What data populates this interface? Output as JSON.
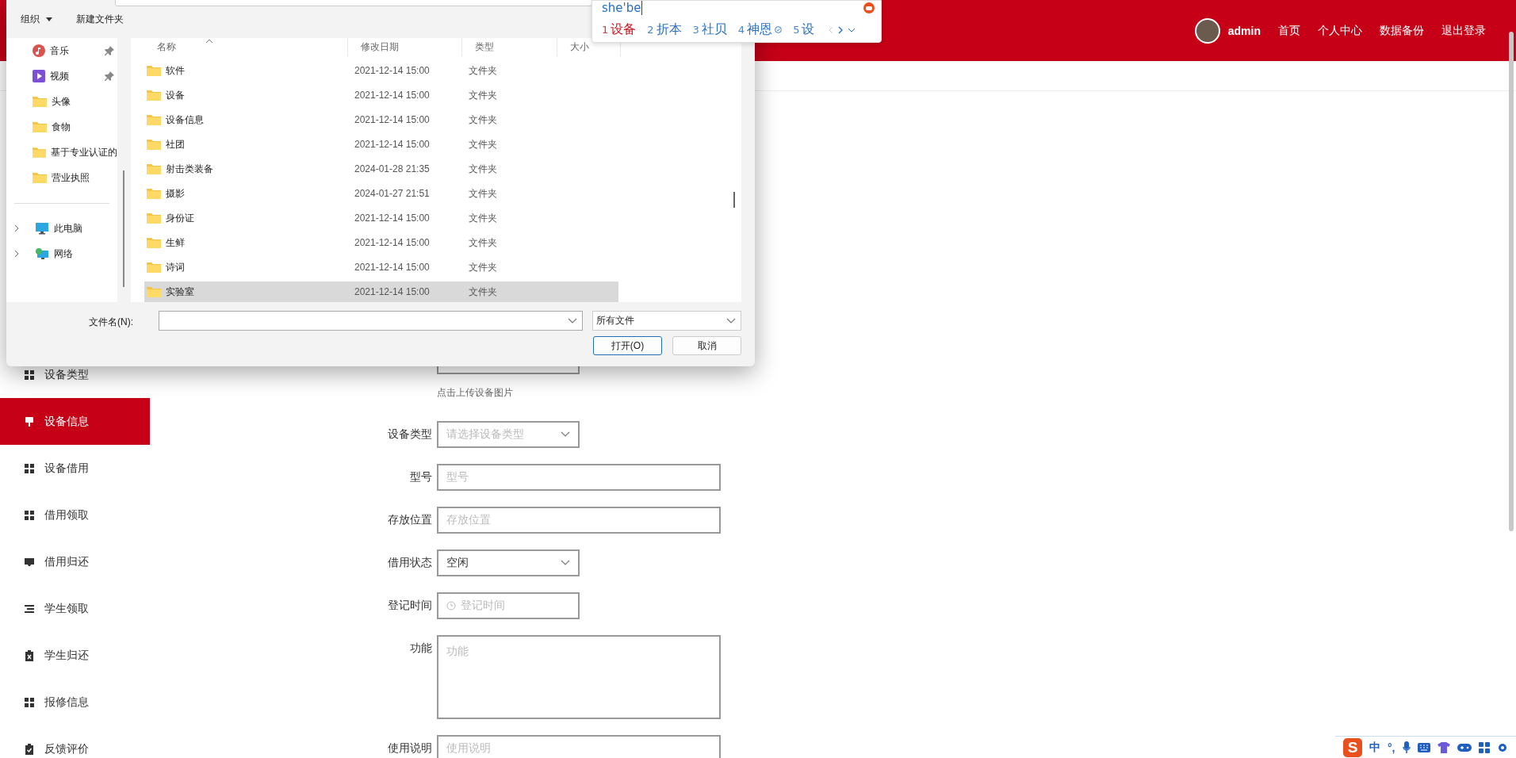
{
  "header": {
    "user": "admin",
    "nav": [
      "首页",
      "个人中心",
      "数据备份",
      "退出登录"
    ]
  },
  "sidebar": {
    "items": [
      {
        "label": "设备类型",
        "kind": "grid",
        "selected": false
      },
      {
        "label": "设备信息",
        "kind": "pin",
        "selected": true
      },
      {
        "label": "设备借用",
        "kind": "grid",
        "selected": false
      },
      {
        "label": "借用领取",
        "kind": "grid",
        "selected": false
      },
      {
        "label": "借用归还",
        "kind": "tray",
        "selected": false
      },
      {
        "label": "学生领取",
        "kind": "list",
        "selected": false
      },
      {
        "label": "学生归还",
        "kind": "clipx",
        "selected": false
      },
      {
        "label": "报修信息",
        "kind": "grid",
        "selected": false
      },
      {
        "label": "反馈评价",
        "kind": "clipcheck",
        "selected": false
      }
    ]
  },
  "form": {
    "upload_hint": "点击上传设备图片",
    "fields": [
      {
        "label": "设备类型",
        "kind": "select",
        "placeholder": "请选择设备类型"
      },
      {
        "label": "型号",
        "kind": "text",
        "placeholder": "型号"
      },
      {
        "label": "存放位置",
        "kind": "text",
        "placeholder": "存放位置"
      },
      {
        "label": "借用状态",
        "kind": "select",
        "value": "空闲"
      },
      {
        "label": "登记时间",
        "kind": "date",
        "placeholder": "登记时间"
      },
      {
        "label": "功能",
        "kind": "textarea",
        "placeholder": "功能"
      },
      {
        "label": "使用说明",
        "kind": "text",
        "placeholder": "使用说明"
      }
    ]
  },
  "file_dialog": {
    "toolbar": [
      {
        "label": "组织",
        "menu": true
      },
      {
        "label": "新建文件夹",
        "menu": false
      }
    ],
    "nav": [
      {
        "label": "音乐",
        "kind": "music",
        "pinned": true
      },
      {
        "label": "视频",
        "kind": "video",
        "pinned": true
      },
      {
        "label": "头像",
        "kind": "folder",
        "pinned": false
      },
      {
        "label": "食物",
        "kind": "folder",
        "pinned": false
      },
      {
        "label": "基于专业认证的",
        "kind": "folder",
        "pinned": false
      },
      {
        "label": "营业执照",
        "kind": "folder",
        "pinned": false
      }
    ],
    "locations": [
      {
        "label": "此电脑",
        "kind": "pc"
      },
      {
        "label": "网络",
        "kind": "network"
      }
    ],
    "columns": [
      {
        "label": "名称",
        "sorted": true
      },
      {
        "label": "修改日期",
        "sorted": false
      },
      {
        "label": "类型",
        "sorted": false
      },
      {
        "label": "大小",
        "sorted": false
      }
    ],
    "files": [
      {
        "name": "软件",
        "modified": "2021-12-14 15:00",
        "type": "文件夹",
        "selected": false
      },
      {
        "name": "设备",
        "modified": "2021-12-14 15:00",
        "type": "文件夹",
        "selected": false
      },
      {
        "name": "设备信息",
        "modified": "2021-12-14 15:00",
        "type": "文件夹",
        "selected": false
      },
      {
        "name": "社团",
        "modified": "2021-12-14 15:00",
        "type": "文件夹",
        "selected": false
      },
      {
        "name": "射击类装备",
        "modified": "2024-01-28 21:35",
        "type": "文件夹",
        "selected": false
      },
      {
        "name": "摄影",
        "modified": "2024-01-27 21:51",
        "type": "文件夹",
        "selected": false
      },
      {
        "name": "身份证",
        "modified": "2021-12-14 15:00",
        "type": "文件夹",
        "selected": false
      },
      {
        "name": "生鲜",
        "modified": "2021-12-14 15:00",
        "type": "文件夹",
        "selected": false
      },
      {
        "name": "诗词",
        "modified": "2021-12-14 15:00",
        "type": "文件夹",
        "selected": false
      },
      {
        "name": "实验室",
        "modified": "2021-12-14 15:00",
        "type": "文件夹",
        "selected": true
      }
    ],
    "filename_label": "文件名(N):",
    "filter": "所有文件",
    "buttons": [
      {
        "label": "打开(O)",
        "default": true
      },
      {
        "label": "取消",
        "default": false
      }
    ]
  },
  "ime": {
    "input": "she'be",
    "candidates": [
      {
        "index": "1",
        "text": "设备",
        "selected": true,
        "badge": false
      },
      {
        "index": "2",
        "text": "折本",
        "selected": false,
        "badge": false
      },
      {
        "index": "3",
        "text": "社贝",
        "selected": false,
        "badge": false
      },
      {
        "index": "4",
        "text": "神恩",
        "selected": false,
        "badge": true
      },
      {
        "index": "5",
        "text": "设",
        "selected": false,
        "badge": false
      }
    ]
  },
  "tray": {
    "logo": "S",
    "labels": [
      "中",
      "°,"
    ]
  }
}
